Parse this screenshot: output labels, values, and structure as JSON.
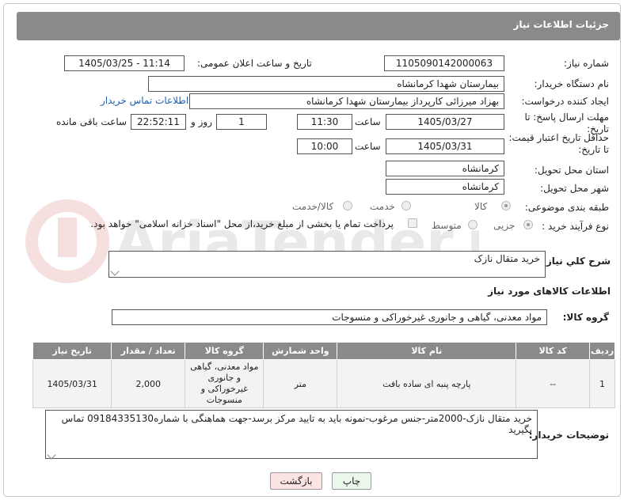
{
  "header": {
    "title": "جزئیات اطلاعات نیاز"
  },
  "fields": {
    "need_number_label": "شماره نیاز:",
    "need_number": "1105090142000063",
    "announce_label": "تاریخ و ساعت اعلان عمومی:",
    "announce_value": "1405/03/25 - 11:14",
    "buyer_org_label": "نام دستگاه خریدار:",
    "buyer_org": "بیمارستان شهدا کرمانشاه",
    "requester_label": "ایجاد کننده درخواست:",
    "requester": "بهزاد میرزائی کارپرداز بیمارستان شهدا کرمانشاه",
    "contact_link": "اطلاعات تماس خریدار",
    "deadline_label": "مهلت ارسال پاسخ: تا تاریخ:",
    "deadline_date": "1405/03/27",
    "time_label": "ساعت",
    "deadline_time": "11:30",
    "days_value": "1",
    "days_label": "روز و",
    "remaining_time": "22:52:11",
    "remaining_label": "ساعت باقی مانده",
    "min_price_label": "حداقل تاریخ اعتبار قیمت: تا تاریخ:",
    "min_price_date": "1405/03/31",
    "min_price_time": "10:00",
    "province_label": "استان محل تحویل:",
    "province": "کرمانشاه",
    "city_label": "شهر محل تحویل:",
    "city": "کرمانشاه",
    "category_label": "طبقه بندی موضوعی:",
    "category_options": [
      "کالا",
      "خدمت",
      "کالا/خدمت"
    ],
    "process_label": "نوع فرآیند خرید :",
    "process_options": [
      "جزیی",
      "متوسط"
    ],
    "payment_note": "پرداخت تمام یا بخشی از مبلغ خرید،از محل \"اسناد خزانه اسلامی\" خواهد بود."
  },
  "summary": {
    "label": "شرح کلي نياز:",
    "value": "خرید متقال نازک"
  },
  "goods_section": {
    "title": "اطلاعات کالاهای مورد نیاز",
    "group_label": "گروه کالا:",
    "group_value": "مواد معدنی، گیاهی و جانوری غیرخوراکی و منسوجات"
  },
  "table": {
    "headers": [
      "ردیف",
      "کد کالا",
      "نام کالا",
      "واحد شمارش",
      "گروه کالا",
      "تعداد / مقدار",
      "تاریخ نیاز"
    ],
    "rows": [
      [
        "1",
        "--",
        "پارچه پنبه ای ساده بافت",
        "متر",
        "مواد معدنی، گیاهی و جانوری غیرخوراکی و منسوجات",
        "2,000",
        "1405/03/31"
      ]
    ]
  },
  "buyer_notes": {
    "label": "توضیحات خریدار:",
    "value": "خرید متقال نازک-2000متر-جنس مرغوب-نمونه باید به تایید مرکز برسد-جهت هماهنگی با شماره09184335130 تماس بگیرید"
  },
  "buttons": {
    "print": "چاپ",
    "back": "بازگشت"
  },
  "colors": {
    "header_bg": "#8a8a8a",
    "link": "#1a5fb4",
    "back_button_bg": "#fde4e4",
    "print_button_bg": "#eaf7ea"
  }
}
